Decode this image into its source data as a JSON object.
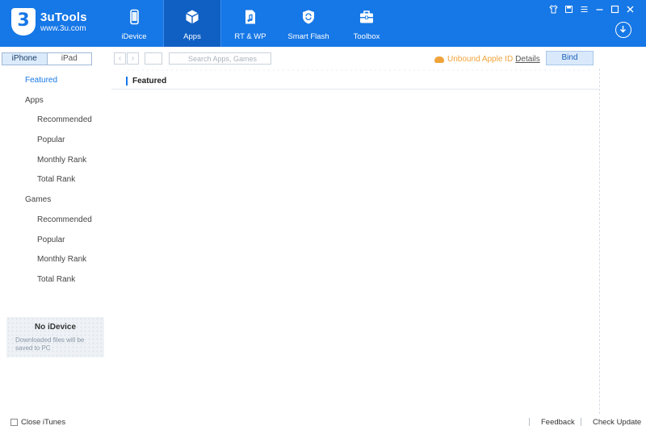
{
  "app": {
    "title": "3uTools",
    "website": "www.3u.com",
    "logo_glyph": "3"
  },
  "nav": [
    {
      "label": "iDevice",
      "icon": "phone-icon",
      "active": false
    },
    {
      "label": "Apps",
      "icon": "cube-icon",
      "active": true
    },
    {
      "label": "RT & WP",
      "icon": "music-file-icon",
      "active": false
    },
    {
      "label": "Smart Flash",
      "icon": "shield-refresh-icon",
      "active": false
    },
    {
      "label": "Toolbox",
      "icon": "briefcase-icon",
      "active": false
    }
  ],
  "window_controls": [
    "shirt-icon",
    "note-icon",
    "menu-icon",
    "minimize-icon",
    "maximize-icon",
    "close-icon"
  ],
  "device_tabs": {
    "iphone": "iPhone",
    "ipad": "iPad",
    "selected": "iPhone"
  },
  "sidebar": {
    "items": [
      {
        "label": "Featured",
        "level": 1,
        "selected": true
      },
      {
        "label": "Apps",
        "level": 1,
        "selected": false
      },
      {
        "label": "Recommended",
        "level": 2,
        "selected": false
      },
      {
        "label": "Popular",
        "level": 2,
        "selected": false
      },
      {
        "label": "Monthly Rank",
        "level": 2,
        "selected": false
      },
      {
        "label": "Total Rank",
        "level": 2,
        "selected": false
      },
      {
        "label": "Games",
        "level": 1,
        "selected": false
      },
      {
        "label": "Recommended",
        "level": 2,
        "selected": false
      },
      {
        "label": "Popular",
        "level": 2,
        "selected": false
      },
      {
        "label": "Monthly Rank",
        "level": 2,
        "selected": false
      },
      {
        "label": "Total Rank",
        "level": 2,
        "selected": false
      }
    ],
    "device_status": {
      "title": "No iDevice",
      "subtitle": "Downloaded files will be saved to PC"
    }
  },
  "toolbar": {
    "back_glyph": "‹",
    "forward_glyph": "›",
    "search_placeholder": "Search Apps, Games",
    "apple_id_status": "Unbound Apple ID",
    "details_link": "Details",
    "bind_label": "Bind"
  },
  "content": {
    "breadcrumb": "Featured"
  },
  "footer": {
    "close_itunes": "Close iTunes",
    "close_itunes_checked": false,
    "feedback": "Feedback",
    "check_update": "Check Update"
  },
  "colors": {
    "brand": "#1677e6",
    "header_active": "#1060c4",
    "warning": "#f0a33a"
  }
}
